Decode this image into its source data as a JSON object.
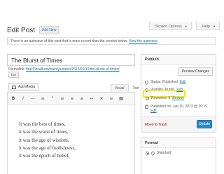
{
  "header": {
    "screen_options": "Screen Options",
    "help": "Help",
    "page_title": "Edit Post",
    "add_new": "Add New"
  },
  "notice": {
    "text": "There is an autosave of this post that is more recent than the version below.",
    "link": "View the autosave"
  },
  "post": {
    "title": "The Blurst of Times",
    "permalink_label": "Permalink:",
    "permalink_url": "http://localhost/twentysixteen/2013/01/10/the-blurst-of-times/",
    "permalink_button": "box"
  },
  "editor": {
    "add_media": "Add Media",
    "tab_visual": "Visual",
    "tab_text": "Text",
    "toolbar": [
      "B",
      "I",
      "—",
      "≡",
      "“",
      "≡",
      "≡",
      "≡",
      "↔",
      "✕",
      "≡",
      "▦"
    ],
    "lines": [
      "It was the best of times,",
      "it was the worst of times,",
      "it was the age of wisdom,",
      "it was the age of foolishness,",
      "it was the epoch of belief,"
    ]
  },
  "publish": {
    "heading": "Publish",
    "preview": "Preview Changes",
    "status_label": "Status: Published",
    "status_edit": "Edit",
    "visibility_label": "Visibility: Public",
    "visibility_edit": "Edit",
    "revisions_label": "Revisions: 5",
    "revisions_link": "Browse",
    "published_on": "Published on: Jan 10, 2013 @ 20:15",
    "published_edit": "Edit",
    "trash": "Move to Trash",
    "update": "Update",
    "highlight_color": "#ffe800",
    "update_color": "#2a8bc8"
  },
  "format": {
    "heading": "Format",
    "option": "Standard"
  }
}
